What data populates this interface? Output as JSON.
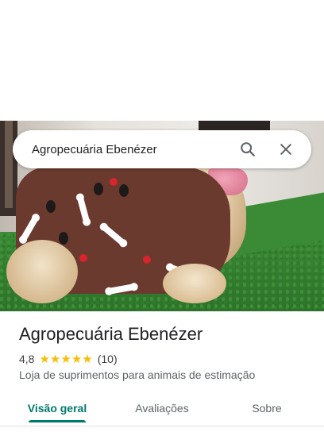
{
  "search": {
    "query": "Agropecuária Ebenézer",
    "search_icon": "search-icon",
    "close_icon": "close-icon"
  },
  "hero": {
    "description_icon": "place-photo"
  },
  "place": {
    "name": "Agropecuária Ebenézer",
    "rating": "4,8",
    "stars": 5,
    "review_count": "(10)",
    "category": "Loja de suprimentos para animais de estimação"
  },
  "tabs": [
    {
      "label": "Visão geral",
      "active": true
    },
    {
      "label": "Avaliações",
      "active": false
    },
    {
      "label": "Sobre",
      "active": false
    }
  ],
  "colors": {
    "accent": "#00796b",
    "star": "#fbbc04",
    "text_primary": "#202124",
    "text_secondary": "#5f6368"
  }
}
